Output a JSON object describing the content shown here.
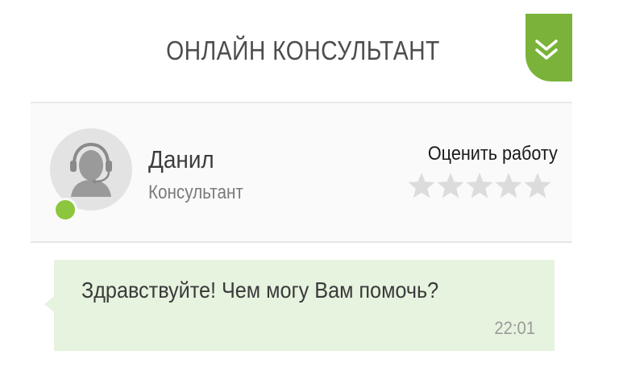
{
  "header": {
    "title": "ОНЛАЙН КОНСУЛЬТАНТ",
    "collapse_icon": "double-chevron-down-icon"
  },
  "operator": {
    "name": "Данил",
    "role": "Консультант",
    "avatar_icon": "headset-operator-icon",
    "status": "online",
    "status_color": "#8cc63e"
  },
  "rating": {
    "label": "Оценить работу",
    "max": 5,
    "value": 0
  },
  "messages": [
    {
      "text": "Здравствуйте! Чем могу Вам помочь?",
      "time": "22:01"
    }
  ],
  "colors": {
    "accent": "#7bb33a",
    "bubble_bg": "#e6f3df",
    "star_empty": "#dcdcdc"
  }
}
